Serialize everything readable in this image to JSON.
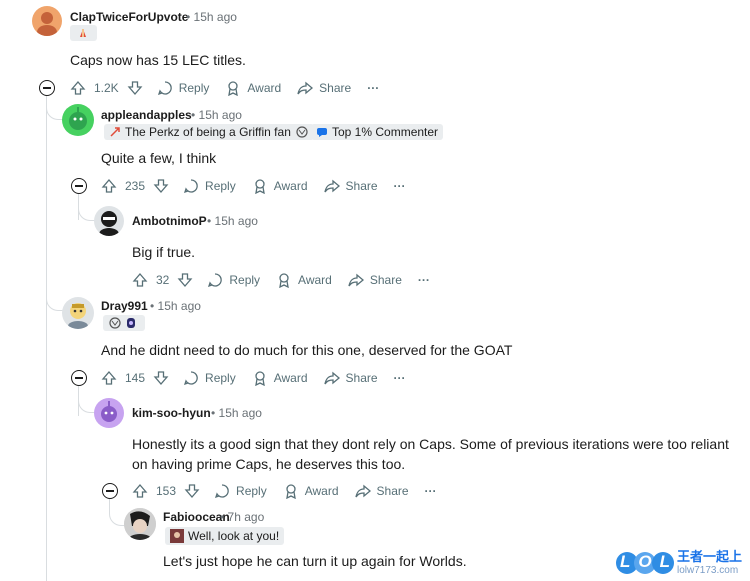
{
  "comments": [
    {
      "username": "ClapTwiceForUpvote",
      "time": "15h ago",
      "body": "Caps now has 15 LEC titles.",
      "votes": "1.2K"
    },
    {
      "username": "appleandapples",
      "time": "15h ago",
      "flair": "The Perkz of being a Griffin fan",
      "badge": "Top 1% Commenter",
      "body": "Quite a few, I think",
      "votes": "235"
    },
    {
      "username": "AmbotnimoP",
      "time": "15h ago",
      "body": "Big if true.",
      "votes": "32"
    },
    {
      "username": "Dray991",
      "time": "15h ago",
      "body": "And he didnt need to do much for this one, deserved for the GOAT",
      "votes": "145"
    },
    {
      "username": "kim-soo-hyun",
      "time": "15h ago",
      "body": "Honestly its a good sign that they dont rely on Caps. Some of previous iterations were too reliant on having prime Caps, he deserves this too.",
      "votes": "153"
    },
    {
      "username": "Fabioocean",
      "time": "7h ago",
      "flair": "Well, look at you!",
      "body": "Let's just hope he can turn it up again for Worlds."
    }
  ],
  "actions": {
    "reply": "Reply",
    "award": "Award",
    "share": "Share",
    "more": "···",
    "dot": "•"
  },
  "watermark": {
    "logo": "LOL",
    "cn": "王者一起上",
    "url": "lolw7173.com"
  },
  "colors": {
    "orange_avatar": "#f0a46b",
    "green_avatar": "#46d160",
    "purple_avatar": "#c7a3f0",
    "accent_blue": "#1a73e8"
  }
}
